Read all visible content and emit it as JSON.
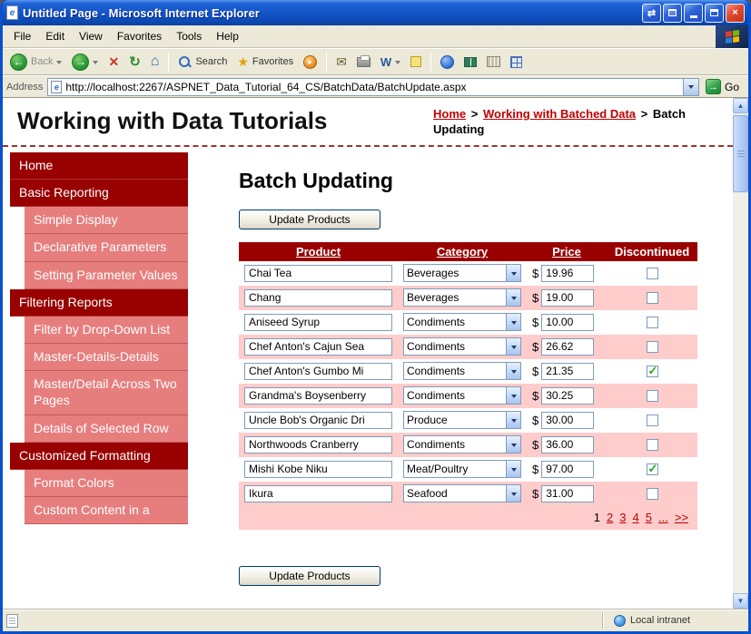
{
  "window": {
    "title": "Untitled Page - Microsoft Internet Explorer",
    "menu": [
      "File",
      "Edit",
      "View",
      "Favorites",
      "Tools",
      "Help"
    ],
    "toolbar": {
      "back": "Back",
      "search": "Search",
      "favorites": "Favorites"
    },
    "address": {
      "label": "Address",
      "url": "http://localhost:2267/ASPNET_Data_Tutorial_64_CS/BatchData/BatchUpdate.aspx",
      "go": "Go"
    },
    "status_text": "Local intranet"
  },
  "icons": {
    "ie_e": "e",
    "titlebar_arrows": "⇄",
    "close": "×",
    "back_arrow": "←",
    "forward_arrow": "→",
    "stop": "✕",
    "refresh": "↻",
    "home": "⌂",
    "favorites_star": "★",
    "media_play": "▸",
    "mail_envelope": "✉",
    "word_w": "W",
    "go_arrow": "→",
    "scroll_up": "▲",
    "scroll_down": "▼",
    "check": "✓"
  },
  "page": {
    "site_title": "Working with Data Tutorials",
    "breadcrumb": {
      "home": "Home",
      "separator": ">",
      "section": "Working with Batched Data",
      "current": "Batch Updating"
    },
    "heading": "Batch Updating",
    "update_button": "Update Products"
  },
  "sidebar": {
    "items": [
      {
        "label": "Home"
      },
      {
        "label": "Basic Reporting"
      },
      {
        "label": "Simple Display"
      },
      {
        "label": "Declarative Parameters"
      },
      {
        "label": "Setting Parameter Values"
      },
      {
        "label": "Filtering Reports"
      },
      {
        "label": "Filter by Drop-Down List"
      },
      {
        "label": "Master-Details-Details"
      },
      {
        "label": "Master/Detail Across Two Pages"
      },
      {
        "label": "Details of Selected Row"
      },
      {
        "label": "Customized Formatting"
      },
      {
        "label": "Format Colors"
      },
      {
        "label": "Custom Content in a"
      }
    ]
  },
  "table": {
    "headers": [
      "Product",
      "Category",
      "Price",
      "Discontinued"
    ],
    "currency": "$",
    "rows": [
      {
        "product": "Chai Tea",
        "category": "Beverages",
        "price": "19.96",
        "discontinued": false
      },
      {
        "product": "Chang",
        "category": "Beverages",
        "price": "19.00",
        "discontinued": false
      },
      {
        "product": "Aniseed Syrup",
        "category": "Condiments",
        "price": "10.00",
        "discontinued": false
      },
      {
        "product": "Chef Anton's Cajun Sea",
        "category": "Condiments",
        "price": "26.62",
        "discontinued": false
      },
      {
        "product": "Chef Anton's Gumbo Mi",
        "category": "Condiments",
        "price": "21.35",
        "discontinued": true
      },
      {
        "product": "Grandma's Boysenberry",
        "category": "Condiments",
        "price": "30.25",
        "discontinued": false
      },
      {
        "product": "Uncle Bob's Organic Dri",
        "category": "Produce",
        "price": "30.00",
        "discontinued": false
      },
      {
        "product": "Northwoods Cranberry",
        "category": "Condiments",
        "price": "36.00",
        "discontinued": false
      },
      {
        "product": "Mishi Kobe Niku",
        "category": "Meat/Poultry",
        "price": "97.00",
        "discontinued": true
      },
      {
        "product": "Ikura",
        "category": "Seafood",
        "price": "31.00",
        "discontinued": false
      }
    ],
    "pager": {
      "current": "1",
      "links": [
        "2",
        "3",
        "4",
        "5"
      ],
      "ellipsis": "...",
      "last": ">>"
    }
  },
  "colors": {
    "titlebar_blue": "#1353C4",
    "chrome_tan": "#ECE9D8",
    "header_maroon": "#990000",
    "sidebar_item_pink": "#E77E7E",
    "row_pink": "#FFCCCC",
    "link_red": "#C00000",
    "check_green": "#1FA81F"
  }
}
